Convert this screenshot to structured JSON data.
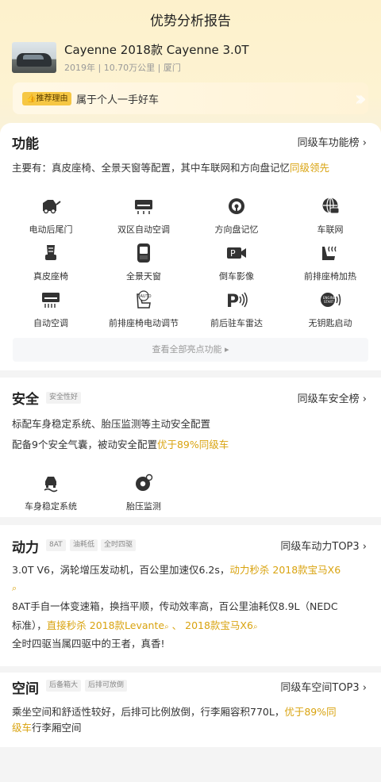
{
  "header": {
    "title": "优势分析报告",
    "car_name": "Cayenne 2018款 Cayenne 3.0T",
    "car_meta": "2019年 | 10.70万公里 | 厦门",
    "reason_tag": "推荐理由",
    "reason_text": "属于个人一手好车"
  },
  "function": {
    "title": "功能",
    "link": "同级车功能榜 ›",
    "desc_prefix": "主要有：真皮座椅、全景天窗等配置，其中车联网和方向盘记忆",
    "desc_highlight": "同级领先",
    "features": [
      {
        "label": "电动后尾门",
        "icon": "tailgate-icon"
      },
      {
        "label": "双区自动空调",
        "icon": "dual-ac-icon"
      },
      {
        "label": "方向盘记忆",
        "icon": "steering-memory-icon"
      },
      {
        "label": "车联网",
        "icon": "connected-car-icon"
      },
      {
        "label": "真皮座椅",
        "icon": "leather-seat-icon"
      },
      {
        "label": "全景天窗",
        "icon": "sunroof-icon"
      },
      {
        "label": "倒车影像",
        "icon": "rear-camera-icon"
      },
      {
        "label": "前排座椅加热",
        "icon": "seat-heating-icon"
      },
      {
        "label": "自动空调",
        "icon": "auto-ac-icon"
      },
      {
        "label": "前排座椅电动调节",
        "icon": "power-seat-icon"
      },
      {
        "label": "前后驻车雷达",
        "icon": "parking-radar-icon"
      },
      {
        "label": "无钥匙启动",
        "icon": "keyless-start-icon"
      }
    ],
    "more": "查看全部亮点功能 ▸"
  },
  "safety": {
    "title": "安全",
    "tag": "安全性好",
    "link": "同级车安全榜 ›",
    "line1": "标配车身稳定系统、胎压监测等主动安全配置",
    "line2_prefix": "配备9个安全气囊，被动安全配置",
    "line2_highlight": "优于89%同级车",
    "features": [
      {
        "label": "车身稳定系统",
        "icon": "stability-control-icon"
      },
      {
        "label": "胎压监测",
        "icon": "tire-pressure-icon"
      }
    ]
  },
  "power": {
    "title": "动力",
    "tags": [
      "8AT",
      "油耗低",
      "全时四驱"
    ],
    "link": "同级车动力TOP3 ›",
    "line1_prefix": "3.0T V6，涡轮增压发动机，百公里加速仅6.2s，",
    "line1_highlight": "动力秒杀 2018款宝马X6",
    "line2": "8AT手自一体变速箱，换挡平顺，传动效率高，百公里油耗仅8.9L（NEDC",
    "line3_prefix": "标准），",
    "line3_highlight1": "直接秒杀 2018款Levante",
    "line3_sep": " 、 ",
    "line3_highlight2": "2018款宝马X6",
    "line4": "全时四驱当属四驱中的王者，真香!"
  },
  "space": {
    "title": "空间",
    "tags": [
      "后备箱大",
      "后排可放倒"
    ],
    "link": "同级车空间TOP3 ›",
    "line1_prefix": "乘坐空间和舒适性较好，后排可比例放倒，行李厢容积770L，",
    "line1_highlight": "优于89%同",
    "line2_highlight": "级车",
    "line2_suffix": "行李厢空间"
  }
}
